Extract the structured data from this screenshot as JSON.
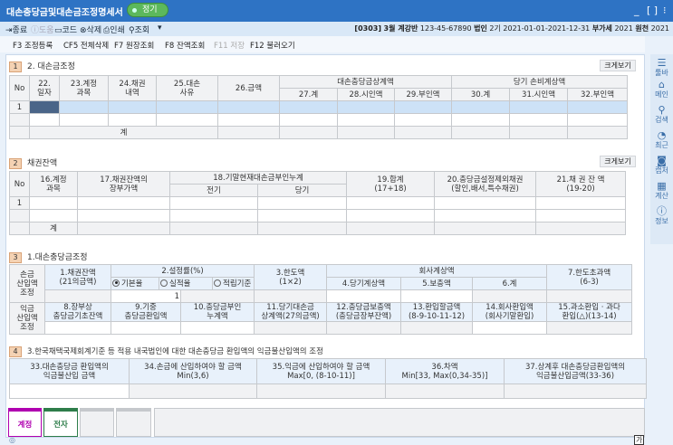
{
  "window": {
    "title": "대손충당금및대손금조정명세서",
    "badge": "정기"
  },
  "toolbar": {
    "items": [
      {
        "label": "종료",
        "icon": "exit-icon"
      },
      {
        "label": "도움",
        "icon": "help-icon",
        "disabled": true
      },
      {
        "label": "코드",
        "icon": "code-icon"
      },
      {
        "label": "삭제",
        "icon": "delete-icon"
      },
      {
        "label": "인쇄",
        "icon": "print-icon"
      },
      {
        "label": "조회",
        "icon": "search-icon"
      }
    ],
    "more": "▾"
  },
  "company": {
    "code": "[0303]",
    "name": "3월 계강반",
    "bizno": "123-45-67890",
    "type_label": "법인",
    "period_no": "2기",
    "period": "2021-01-01-2021-12-31",
    "vat_label": "부가세",
    "vat_year": "2021",
    "withholding_label": "원천",
    "withholding_year": "2021"
  },
  "fkeys": [
    {
      "label": "F3 조정등록"
    },
    {
      "label": "CF5 전체삭제"
    },
    {
      "label": "F7 원장조회"
    },
    {
      "label": "F8 잔액조회"
    },
    {
      "label": "F11 저장",
      "disabled": true
    },
    {
      "label": "F12 불러오기"
    }
  ],
  "sidebar": [
    {
      "label": "툴바",
      "icon": "menu-icon"
    },
    {
      "label": "메인",
      "icon": "home-icon"
    },
    {
      "label": "검색",
      "icon": "search-icon"
    },
    {
      "label": "최근",
      "icon": "clock-icon"
    },
    {
      "label": "캡처",
      "icon": "camera-icon"
    },
    {
      "label": "계산",
      "icon": "calculator-icon"
    },
    {
      "label": "정보",
      "icon": "info-icon"
    }
  ],
  "zoom_label": "크게보기",
  "section1": {
    "num": "1",
    "title": "2. 대손금조정",
    "headers": {
      "no": "No",
      "c22": "22.\n일자",
      "c23": "23.계정\n과목",
      "c24": "24.채권\n내역",
      "c25": "25.대손\n사유",
      "c26": "26.금액",
      "g1": "대손충당금상계액",
      "c27": "27.계",
      "c28": "28.시인액",
      "c29": "29.부인액",
      "g2": "당기 손비계상액",
      "c30": "30.계",
      "c31": "31.시인액",
      "c32": "32.부인액"
    },
    "rows": [
      {
        "no": "1"
      }
    ],
    "total": "계"
  },
  "section2": {
    "num": "2",
    "title": "채권잔액",
    "headers": {
      "no": "No",
      "c16": "16.계정\n과목",
      "c17": "17.채권잔액의\n장부가액",
      "g18": "18.기말현재대손금부인누계",
      "prev": "전기",
      "curr": "당기",
      "c19": "19.합계\n(17+18)",
      "c20": "20.충당금설정제외채권\n(할인,배서,특수채권)",
      "c21": "21.채 권 잔 액\n(19-20)"
    },
    "rows": [
      {
        "no": "1"
      }
    ],
    "total": "계"
  },
  "section3": {
    "num": "3",
    "title": "1.대손충당금조정",
    "row1_label": "손금\n산입액\n조정",
    "row2_label": "익금\n산입액\n조정",
    "h1": "1.채권잔액\n(21의금액)",
    "h2": "2.설정률(%)",
    "radios": [
      "기본율",
      "실적율",
      "적립기준"
    ],
    "selected_radio": 0,
    "rate_value": "1",
    "h3": "3.한도액\n(1×2)",
    "g_company": "회사계상액",
    "h4": "4.당기계상액",
    "h5": "5.보충액",
    "h6": "6.계",
    "h7": "7.한도초과액\n(6-3)",
    "h8": "8.장부상\n충당금기초잔액",
    "h9": "9.기중\n충당금환입액",
    "h10": "10.충당금부인\n누계액",
    "h11": "11.당기대손금\n상계액(27의금액)",
    "h12": "12.충당금보충액\n(충당금장부잔액)",
    "h13": "13.환입할금액\n(8-9-10-11-12)",
    "h14": "14.회사환입액\n(회사기말환입)",
    "h15": "15.과소환입 · 과다\n환입(△)(13-14)"
  },
  "section4": {
    "num": "4",
    "title": "3.한국채택국제회계기준 등 적용 내국법인에 대한 대손충당금 환입액의 익금불산입액의 조정",
    "h33": "33.대손충당금 환입액의\n익금불산입 금액",
    "h34": "34.손금에 산입하여야 할 금액\nMin(3,6)",
    "h35": "35.익금에 산입하여야 할 금액\nMax[0, (8-10-11)]",
    "h36": "36.차액\nMin[33, Max(0,34-35)]",
    "h37": "37.상계후 대손충당금환입액의\n익금불산입금액(33-36)"
  },
  "tabs": [
    {
      "label": "계정",
      "color": "#b000b0"
    },
    {
      "label": "전자",
      "color": "#2e7d4a"
    }
  ],
  "status": {
    "ime": "가"
  }
}
